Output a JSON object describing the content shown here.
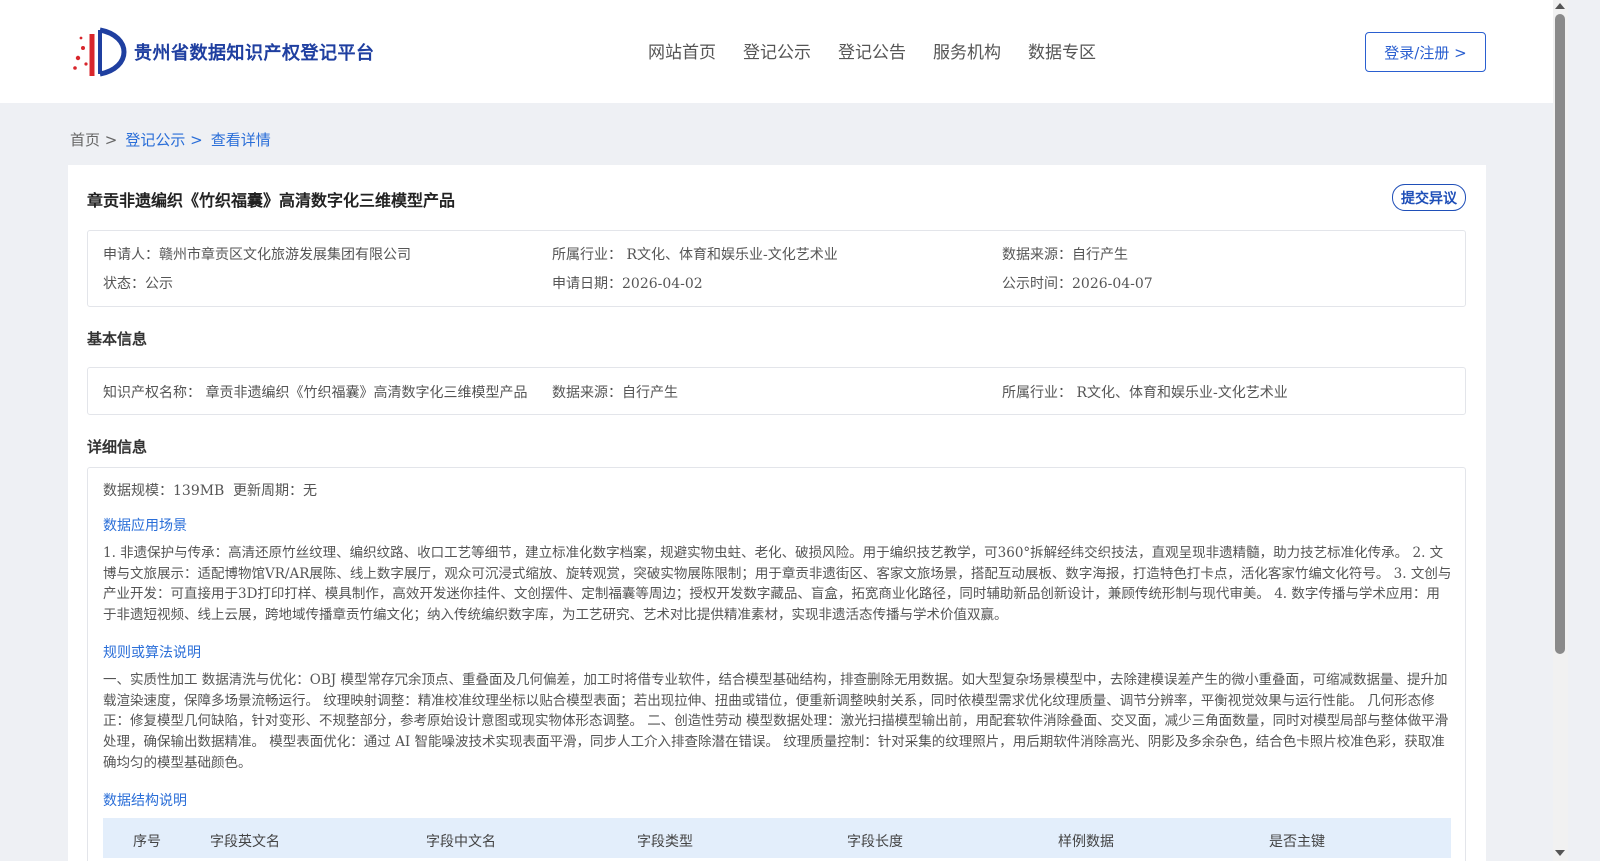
{
  "header": {
    "logo_title": "贵州省数据知识产权登记平台",
    "nav": [
      "网站首页",
      "登记公示",
      "登记公告",
      "服务机构",
      "数据专区"
    ],
    "login_label": "登录/注册 >"
  },
  "breadcrumb": {
    "home": "首页 >",
    "level1": "登记公示 >",
    "level2": "查看详情"
  },
  "detail": {
    "title": "章贡非遗编织《竹织福囊》高清数字化三维模型产品",
    "objection_label": "提交异议",
    "applicant": "申请人：赣州市章贡区文化旅游发展集团有限公司",
    "industry": "所属行业： R文化、体育和娱乐业-文化艺术业",
    "data_source": "数据来源：自行产生",
    "status": "状态：公示",
    "apply_date": "申请日期：2026-04-02",
    "publicity_time": "公示时间：2026-04-07"
  },
  "basic": {
    "section_title": "基本信息",
    "ip_name": "知识产权名称： 章贡非遗编织《竹织福囊》高清数字化三维模型产品",
    "data_source": "数据来源：自行产生",
    "industry": "所属行业： R文化、体育和娱乐业-文化艺术业"
  },
  "details_info": {
    "section_title": "详细信息",
    "scale": "数据规模：139MB",
    "update_cycle": "更新周期：无",
    "scenario_title": "数据应用场景",
    "scenario_text": "1. 非遗保护与传承：高清还原竹丝纹理、编织纹路、收口工艺等细节，建立标准化数字档案，规避实物虫蛀、老化、破损风险。用于编织技艺教学，可360°拆解经纬交织技法，直观呈现非遗精髓，助力技艺标准化传承。 2. 文博与文旅展示：适配博物馆VR/AR展陈、线上数字展厅，观众可沉浸式缩放、旋转观赏，突破实物展陈限制；用于章贡非遗街区、客家文旅场景，搭配互动展板、数字海报，打造特色打卡点，活化客家竹编文化符号。 3. 文创与产业开发：可直接用于3D打印打样、模具制作，高效开发迷你挂件、文创摆件、定制福囊等周边；授权开发数字藏品、盲盒，拓宽商业化路径，同时辅助新品创新设计，兼顾传统形制与现代审美。 4. 数字传播与学术应用：用于非遗短视频、线上云展，跨地域传播章贡竹编文化；纳入传统编织数字库，为工艺研究、艺术对比提供精准素材，实现非遗活态传播与学术价值双赢。",
    "rule_title": "规则或算法说明",
    "rule_text": "一、实质性加工 数据清洗与优化：OBJ 模型常存冗余顶点、重叠面及几何偏差，加工时将借专业软件，结合模型基础结构，排查删除无用数据。如大型复杂场景模型中，去除建模误差产生的微小重叠面，可缩减数据量、提升加载渲染速度，保障多场景流畅运行。 纹理映射调整：精准校准纹理坐标以贴合模型表面；若出现拉伸、扭曲或错位，便重新调整映射关系，同时依模型需求优化纹理质量、调节分辨率，平衡视觉效果与运行性能。 几何形态修正：修复模型几何缺陷，针对变形、不规整部分，参考原始设计意图或现实物体形态调整。 二、创造性劳动 模型数据处理：激光扫描模型输出前，用配套软件消除叠面、交叉面，减少三角面数量，同时对模型局部与整体做平滑处理，确保输出数据精准。 模型表面优化：通过 AI 智能噪波技术实现表面平滑，同步人工介入排查除潜在错误。 纹理质量控制：针对采集的纹理照片，用后期软件消除高光、阴影及多余杂色，结合色卡照片校准色彩，获取准确均匀的模型基础颜色。",
    "structure_title": "数据结构说明",
    "table_headers": [
      "序号",
      "字段英文名",
      "字段中文名",
      "字段类型",
      "字段长度",
      "样例数据",
      "是否主键"
    ]
  }
}
